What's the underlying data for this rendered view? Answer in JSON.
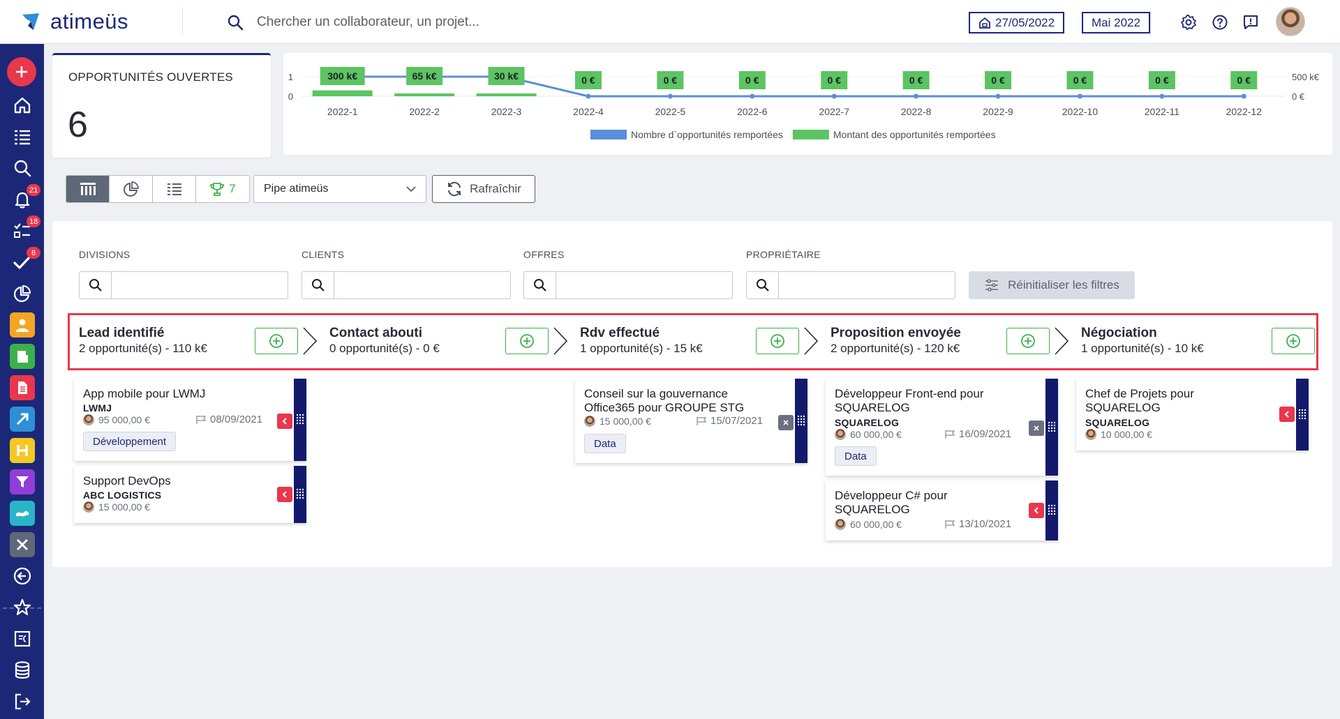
{
  "app": {
    "name": "atimeüs"
  },
  "header": {
    "search_placeholder": "Chercher un collaborateur, un projet...",
    "date": "27/05/2022",
    "period": "Mai 2022"
  },
  "sidebar": {
    "badges": {
      "notifications": "21",
      "tasks": "18",
      "validations": "8"
    },
    "colors": {
      "bg": "#1c2877",
      "add": "#e9374c"
    }
  },
  "kpi": {
    "title": "OPPORTUNITÉS OUVERTES",
    "value": "6"
  },
  "chart_data": {
    "type": "bar",
    "categories": [
      "2022-1",
      "2022-2",
      "2022-3",
      "2022-4",
      "2022-5",
      "2022-6",
      "2022-7",
      "2022-8",
      "2022-9",
      "2022-10",
      "2022-11",
      "2022-12"
    ],
    "series": [
      {
        "name": "Nombre d`opportunités remportées",
        "type": "line",
        "axis": "left",
        "color": "#5b8fdb",
        "values": [
          1,
          1,
          1,
          0,
          0,
          0,
          0,
          0,
          0,
          0,
          0,
          0
        ]
      },
      {
        "name": "Montant des opportunités remportées",
        "type": "bar",
        "axis": "right",
        "color": "#5cc462",
        "values": [
          300,
          65,
          30,
          0,
          0,
          0,
          0,
          0,
          0,
          0,
          0,
          0
        ],
        "labels": [
          "300 k€",
          "65 k€",
          "30 k€",
          "0 €",
          "0 €",
          "0 €",
          "0 €",
          "0 €",
          "0 €",
          "0 €",
          "0 €",
          "0 €"
        ]
      }
    ],
    "left_axis": {
      "ticks": [
        "0",
        "1"
      ],
      "ylim": [
        0,
        1
      ]
    },
    "right_axis": {
      "ticks": [
        "0 €",
        "500 k€"
      ],
      "ylim": [
        0,
        500
      ]
    },
    "legend": "bottom-center"
  },
  "toolbar": {
    "won_count": "7",
    "pipe_selected": "Pipe atimeüs",
    "refresh_label": "Rafraîchir"
  },
  "filters": {
    "divisions": "DIVISIONS",
    "clients": "CLIENTS",
    "offres": "OFFRES",
    "proprietaire": "PROPRIÉTAIRE",
    "reset_label": "Réinitialiser les filtres"
  },
  "stages": [
    {
      "title": "Lead identifié",
      "subtitle": "2 opportunité(s) - 110 k€"
    },
    {
      "title": "Contact abouti",
      "subtitle": "0 opportunité(s) - 0 €"
    },
    {
      "title": "Rdv effectué",
      "subtitle": "1 opportunité(s) - 15 k€"
    },
    {
      "title": "Proposition envoyée",
      "subtitle": "2 opportunité(s) - 120 k€"
    },
    {
      "title": "Négociation",
      "subtitle": "1 opportunité(s) - 10 k€"
    }
  ],
  "cards": [
    {
      "title": "App mobile pour LWMJ",
      "client": "LWMJ",
      "amount": "95 000,00 €",
      "date": "08/09/2021",
      "tag": "Développement"
    },
    {
      "title": "Support DevOps",
      "client": "ABC LOGISTICS",
      "amount": "15 000,00 €"
    },
    {
      "title": "Conseil sur la gouvernance Office365 pour GROUPE STG",
      "amount": "15 000,00 €",
      "date": "15/07/2021",
      "tag": "Data"
    },
    {
      "title": "Développeur Front-end pour SQUARELOG",
      "client": "SQUARELOG",
      "amount": "60 000,00 €",
      "date": "16/09/2021",
      "tag": "Data"
    },
    {
      "title": "Développeur C# pour SQUARELOG",
      "amount": "60 000,00 €",
      "date": "13/10/2021"
    },
    {
      "title": "Chef de Projets pour SQUARELOG",
      "client": "SQUARELOG",
      "amount": "10 000,00 €"
    }
  ]
}
